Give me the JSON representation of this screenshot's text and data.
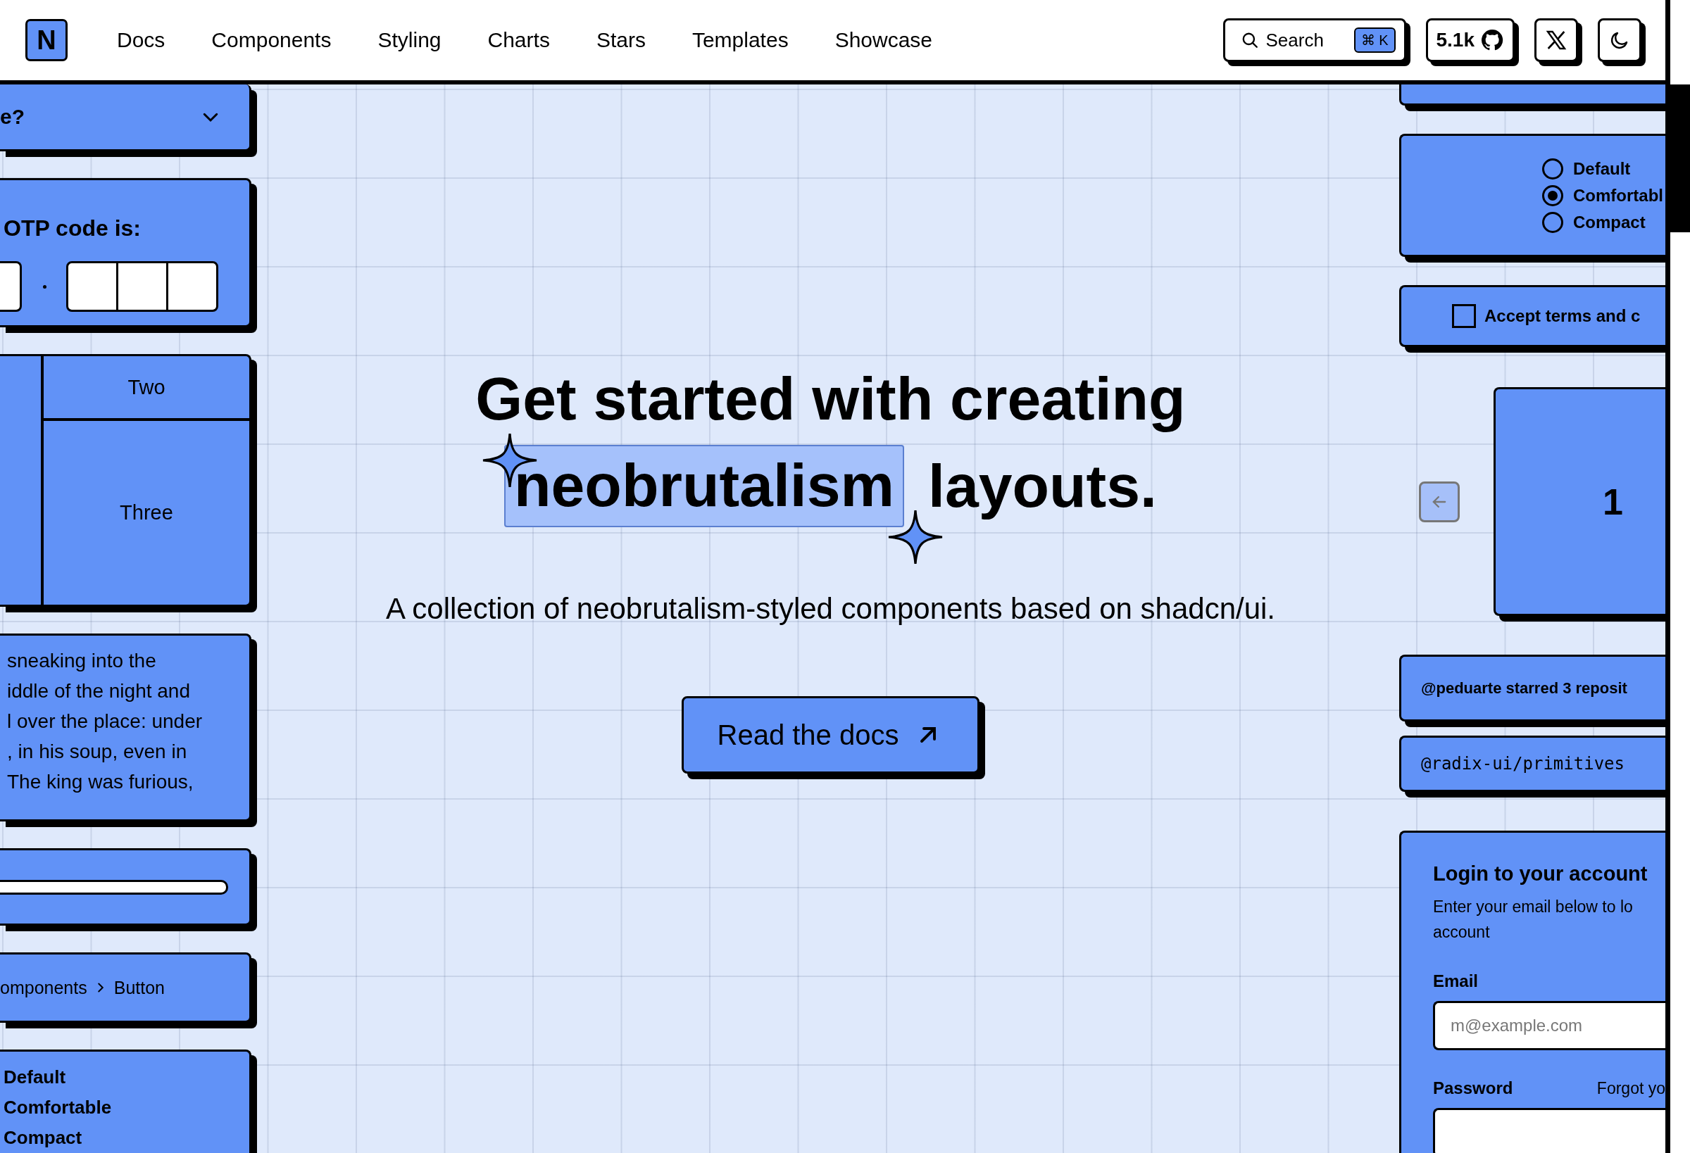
{
  "header": {
    "logo": "N",
    "nav": [
      "Docs",
      "Components",
      "Styling",
      "Charts",
      "Stars",
      "Templates",
      "Showcase"
    ],
    "search": {
      "label": "Search",
      "shortcut": "⌘ K"
    },
    "stars_count": "5.1k"
  },
  "left_column": {
    "accordion": {
      "title": "e?",
      "expanded": false
    },
    "otp": {
      "label": "OTP code is:"
    },
    "resizable": {
      "panels": [
        "Two",
        "Three"
      ]
    },
    "text_card": {
      "text": "sneaking into the\niddle of the night and\nl over the place: under\n, in his soup, even in\nThe king was furious,"
    },
    "breadcrumb": {
      "items": [
        "omponents",
        "Button"
      ]
    },
    "radio_labels": [
      "Default",
      "Comfortable",
      "Compact"
    ]
  },
  "hero": {
    "title_line_1": "Get started with creating",
    "highlight": "neobrutalism",
    "title_end": "layouts.",
    "description": "A collection of neobrutalism-styled components based on shadcn/ui.",
    "button": "Read the docs"
  },
  "right_column": {
    "radio_group": [
      {
        "label": "Default",
        "selected": false
      },
      {
        "label": "Comfortabl",
        "selected": true
      },
      {
        "label": "Compact",
        "selected": false
      }
    ],
    "checkbox": {
      "label": "Accept terms and c",
      "checked": false
    },
    "carousel": {
      "slide": "1",
      "previous_disabled": true
    },
    "hover_card_trigger": "@peduarte starred 3 reposit",
    "collapsible_item": "@radix-ui/primitives",
    "login": {
      "title": "Login to your account",
      "description": "Enter your email below to lo\naccount",
      "email_label": "Email",
      "email_placeholder": "m@example.com",
      "password_label": "Password",
      "forgot_link": "Forgot yo"
    }
  }
}
